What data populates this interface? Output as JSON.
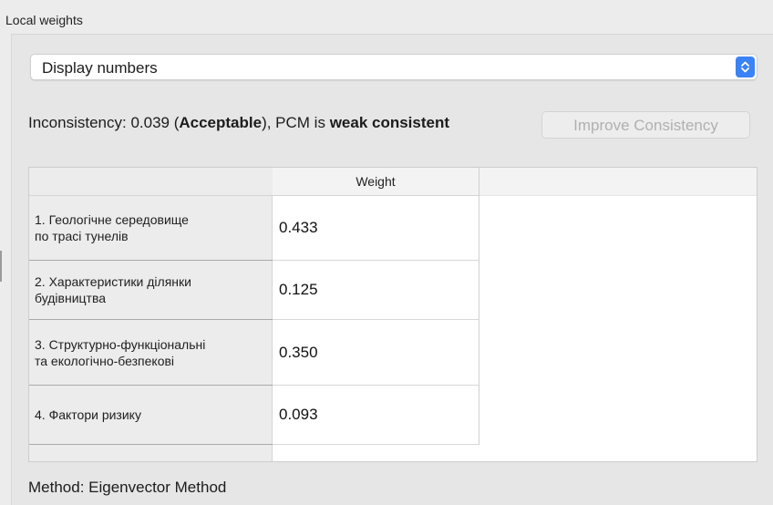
{
  "panel": {
    "title": "Local weights"
  },
  "display_select": {
    "selected": "Display numbers"
  },
  "consistency": {
    "prefix": "Inconsistency: 0.039 (",
    "status": "Acceptable",
    "middle": "), PCM is ",
    "level": "weak consistent",
    "improve_button": "Improve Consistency"
  },
  "table": {
    "column_header": "Weight",
    "rows": [
      {
        "label": "1. Геологічне середовище\nпо трасі тунелів",
        "weight": "0.433"
      },
      {
        "label": "2. Характеристики ділянки\nбудівництва",
        "weight": "0.125"
      },
      {
        "label": "3. Структурно-функціональні\nта екологічно-безпекові",
        "weight": "0.350"
      },
      {
        "label": "4. Фактори ризику",
        "weight": "0.093"
      }
    ]
  },
  "method": {
    "text": "Method: Eigenvector Method"
  },
  "colors": {
    "accent": "#3b82f6",
    "disabled_text": "#b0b0b0"
  }
}
